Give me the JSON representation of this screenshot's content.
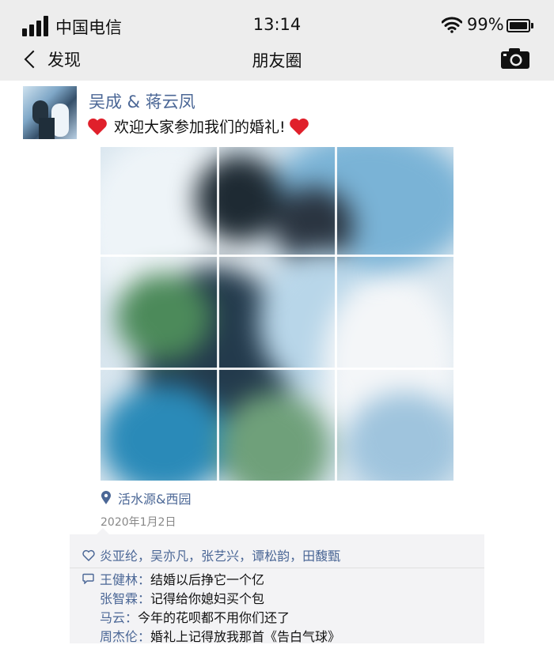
{
  "status": {
    "carrier": "中国电信",
    "time": "13:14",
    "battery": "99%"
  },
  "nav": {
    "back_label": "发现",
    "title": "朋友圈"
  },
  "moment": {
    "author": "吴成 & 蒋云凤",
    "text": "欢迎大家参加我们的婚礼!",
    "location": "活水源&西园",
    "date": "2020年1月2日",
    "likes": [
      "炎亚纶",
      "吴亦凡",
      "张艺兴",
      "谭松韵",
      "田馥甄"
    ],
    "like_separator": "，",
    "comments": [
      {
        "name": "王健林",
        "text": "结婚以后挣它一个亿"
      },
      {
        "name": "张智霖",
        "text": "记得给你媳妇买个包"
      },
      {
        "name": "马云",
        "text": "今年的花呗都不用你们还了"
      },
      {
        "name": "周杰伦",
        "text": "婚礼上记得放我那首《告白气球》"
      }
    ],
    "comment_colon": "："
  },
  "icons": {
    "signal": "signal-bars-icon",
    "wifi": "wifi-icon",
    "battery": "battery-icon",
    "back": "chevron-left-icon",
    "camera": "camera-icon",
    "heart": "red-heart-emoji",
    "location": "location-pin-icon",
    "like": "heart-outline-icon",
    "comment": "comment-bubble-icon"
  },
  "colors": {
    "name_blue": "#4b6796",
    "heart_red": "#e0202b",
    "bar_bg": "#ededed",
    "interaction_bg": "#f3f3f5"
  }
}
